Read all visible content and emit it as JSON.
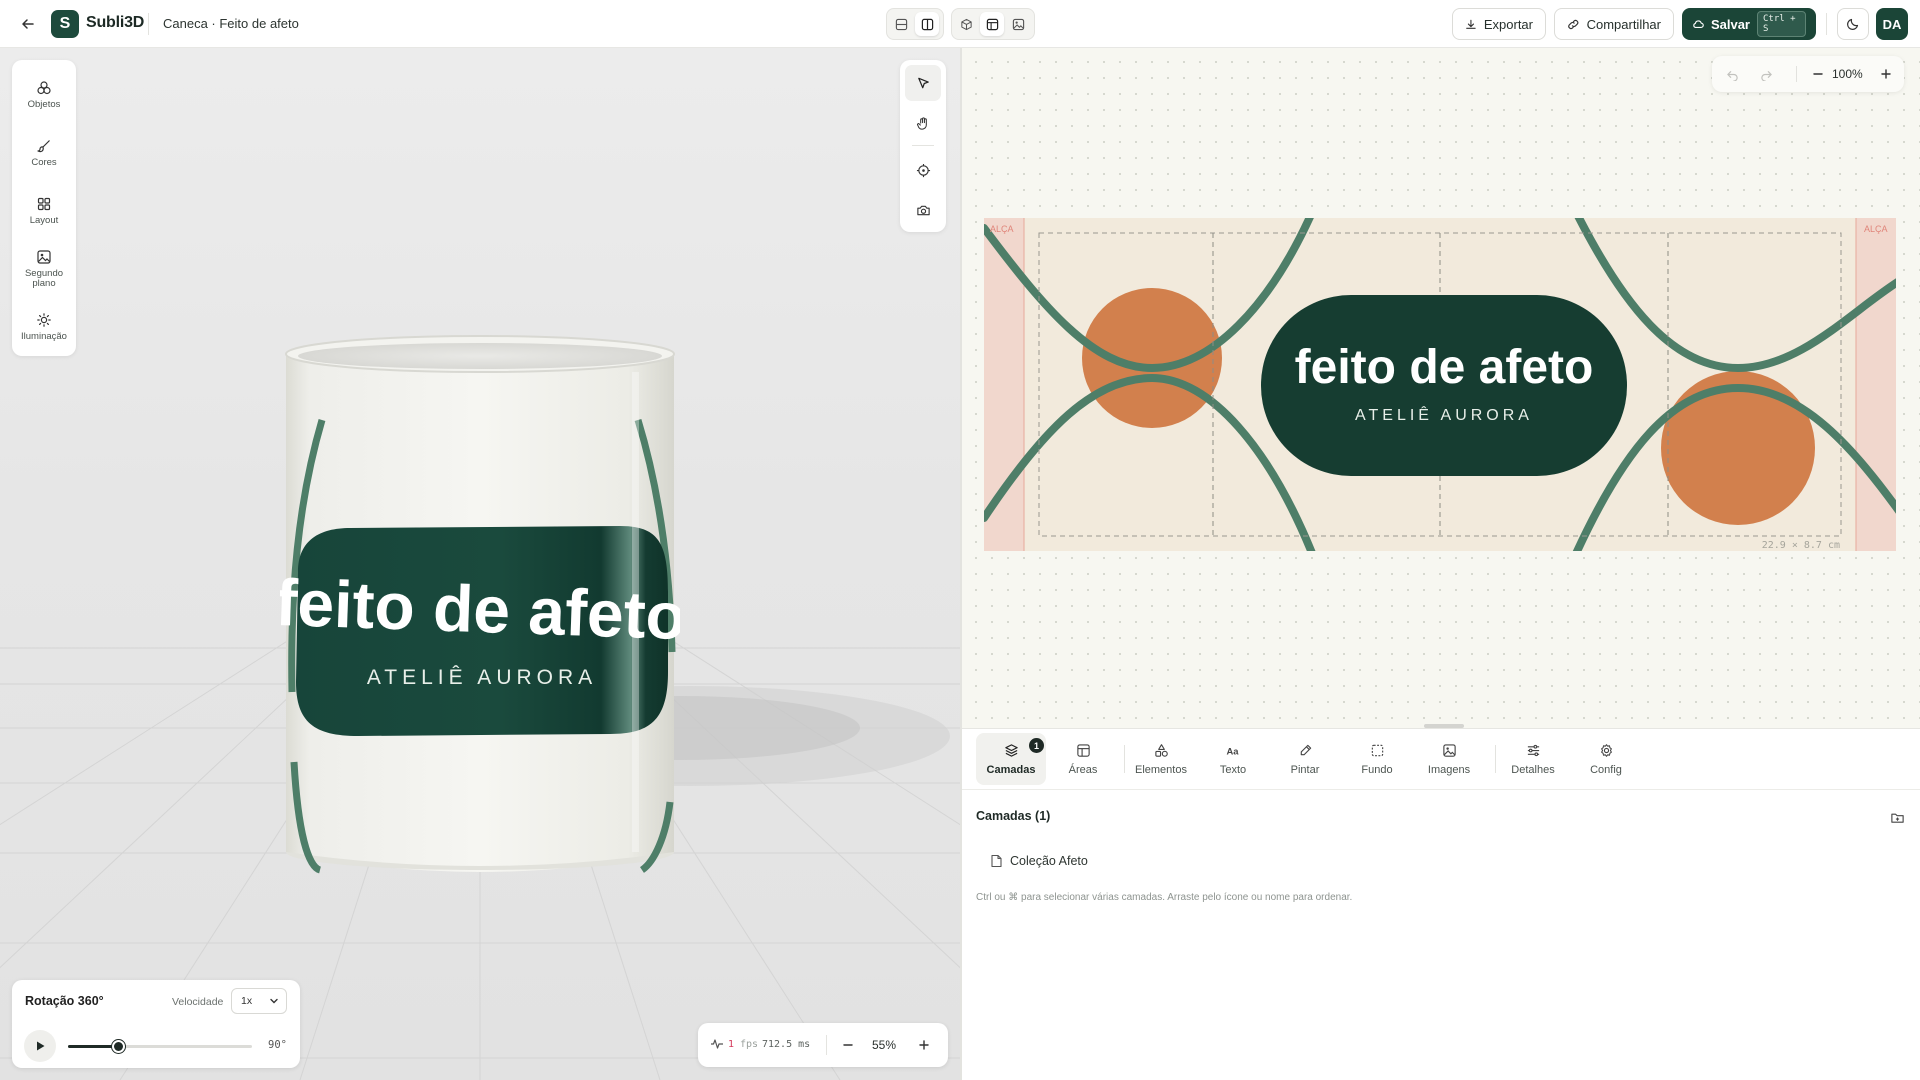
{
  "header": {
    "brand": "Subli3D",
    "logo_letter": "S",
    "project_title": "Caneca · Feito de afeto",
    "export_label": "Exportar",
    "share_label": "Compartilhar",
    "save_label": "Salvar",
    "save_shortcut": "Ctrl + S",
    "avatar_initials": "DA"
  },
  "left_rail": {
    "items": [
      {
        "label": "Objetos",
        "icon": "objects-icon"
      },
      {
        "label": "Cores",
        "icon": "brush-icon"
      },
      {
        "label": "Layout",
        "icon": "grid-icon"
      },
      {
        "label": "Segundo plano",
        "icon": "image-icon"
      },
      {
        "label": "Iluminação",
        "icon": "sun-icon"
      }
    ]
  },
  "mug": {
    "title": "feito de afeto",
    "subtitle": "ATELIÊ AURORA"
  },
  "rotation": {
    "title": "Rotação 360°",
    "speed_label": "Velocidade",
    "speed_value": "1x",
    "progress": 0.27,
    "angle_label": "90°"
  },
  "stats": {
    "fps": "1",
    "fps_unit": "fps",
    "frame_ms": "712.5 ms",
    "zoom": "55%"
  },
  "editor": {
    "zoom": "100%",
    "handle_label_left": "ALÇA",
    "handle_label_right": "ALÇA",
    "dimensions": "22.9 × 8.7 cm",
    "design_title": "feito de afeto",
    "design_subtitle": "ATELIÊ AURORA"
  },
  "colors": {
    "brand_green": "#1b4537",
    "pill_green": "#163d31",
    "wave_green": "#4e7e68",
    "orange": "#d2804d",
    "canvas_beige": "#f2eadc",
    "handle_pink": "#f1d7cd"
  },
  "tabs": {
    "items": [
      {
        "label": "Camadas",
        "icon": "layers-icon"
      },
      {
        "label": "Áreas",
        "icon": "layout-icon"
      },
      {
        "label": "Elementos",
        "icon": "shapes-icon"
      },
      {
        "label": "Texto",
        "icon": "text-icon"
      },
      {
        "label": "Pintar",
        "icon": "paint-icon"
      },
      {
        "label": "Fundo",
        "icon": "background-icon"
      },
      {
        "label": "Imagens",
        "icon": "image-icon"
      },
      {
        "label": "Detalhes",
        "icon": "sliders-icon"
      },
      {
        "label": "Config",
        "icon": "gear-icon"
      }
    ],
    "layers_badge": "1"
  },
  "layers": {
    "title": "Camadas (1)",
    "items": [
      {
        "name": "Coleção Afeto"
      }
    ],
    "hint": "Ctrl ou ⌘ para selecionar várias camadas. Arraste pelo ícone ou nome para ordenar."
  }
}
